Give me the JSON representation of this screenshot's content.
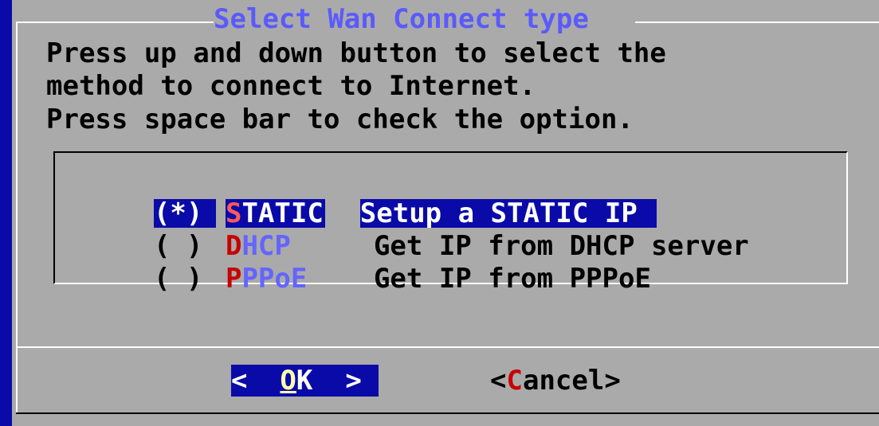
{
  "dialog": {
    "title": "Select Wan Connect type",
    "instructions": [
      "Press up and down button to select the",
      "method to connect to Internet.",
      "Press space bar to check the option."
    ]
  },
  "options": [
    {
      "mark": "(*)",
      "hotkey": "S",
      "rest": "TATIC",
      "description": "Setup a STATIC IP",
      "selected": true
    },
    {
      "mark": "( )",
      "hotkey": "D",
      "rest": "HCP",
      "description": "Get IP from DHCP server",
      "selected": false
    },
    {
      "mark": "( )",
      "hotkey": "P",
      "rest": "PPoE",
      "description": "Get IP from PPPoE",
      "selected": false
    }
  ],
  "buttons": {
    "ok": {
      "left": "<  ",
      "hotkey": "O",
      "rest": "K",
      "right": "  >"
    },
    "cancel": {
      "left": "<",
      "hotkey": "C",
      "rest": "ancel",
      "right": ">"
    }
  },
  "colors": {
    "background": "#0a0aa8",
    "dialog": "#aaaaaa",
    "title": "#5a5afc",
    "hotkey": "#c80000",
    "highlight": "#0a0aa8"
  }
}
